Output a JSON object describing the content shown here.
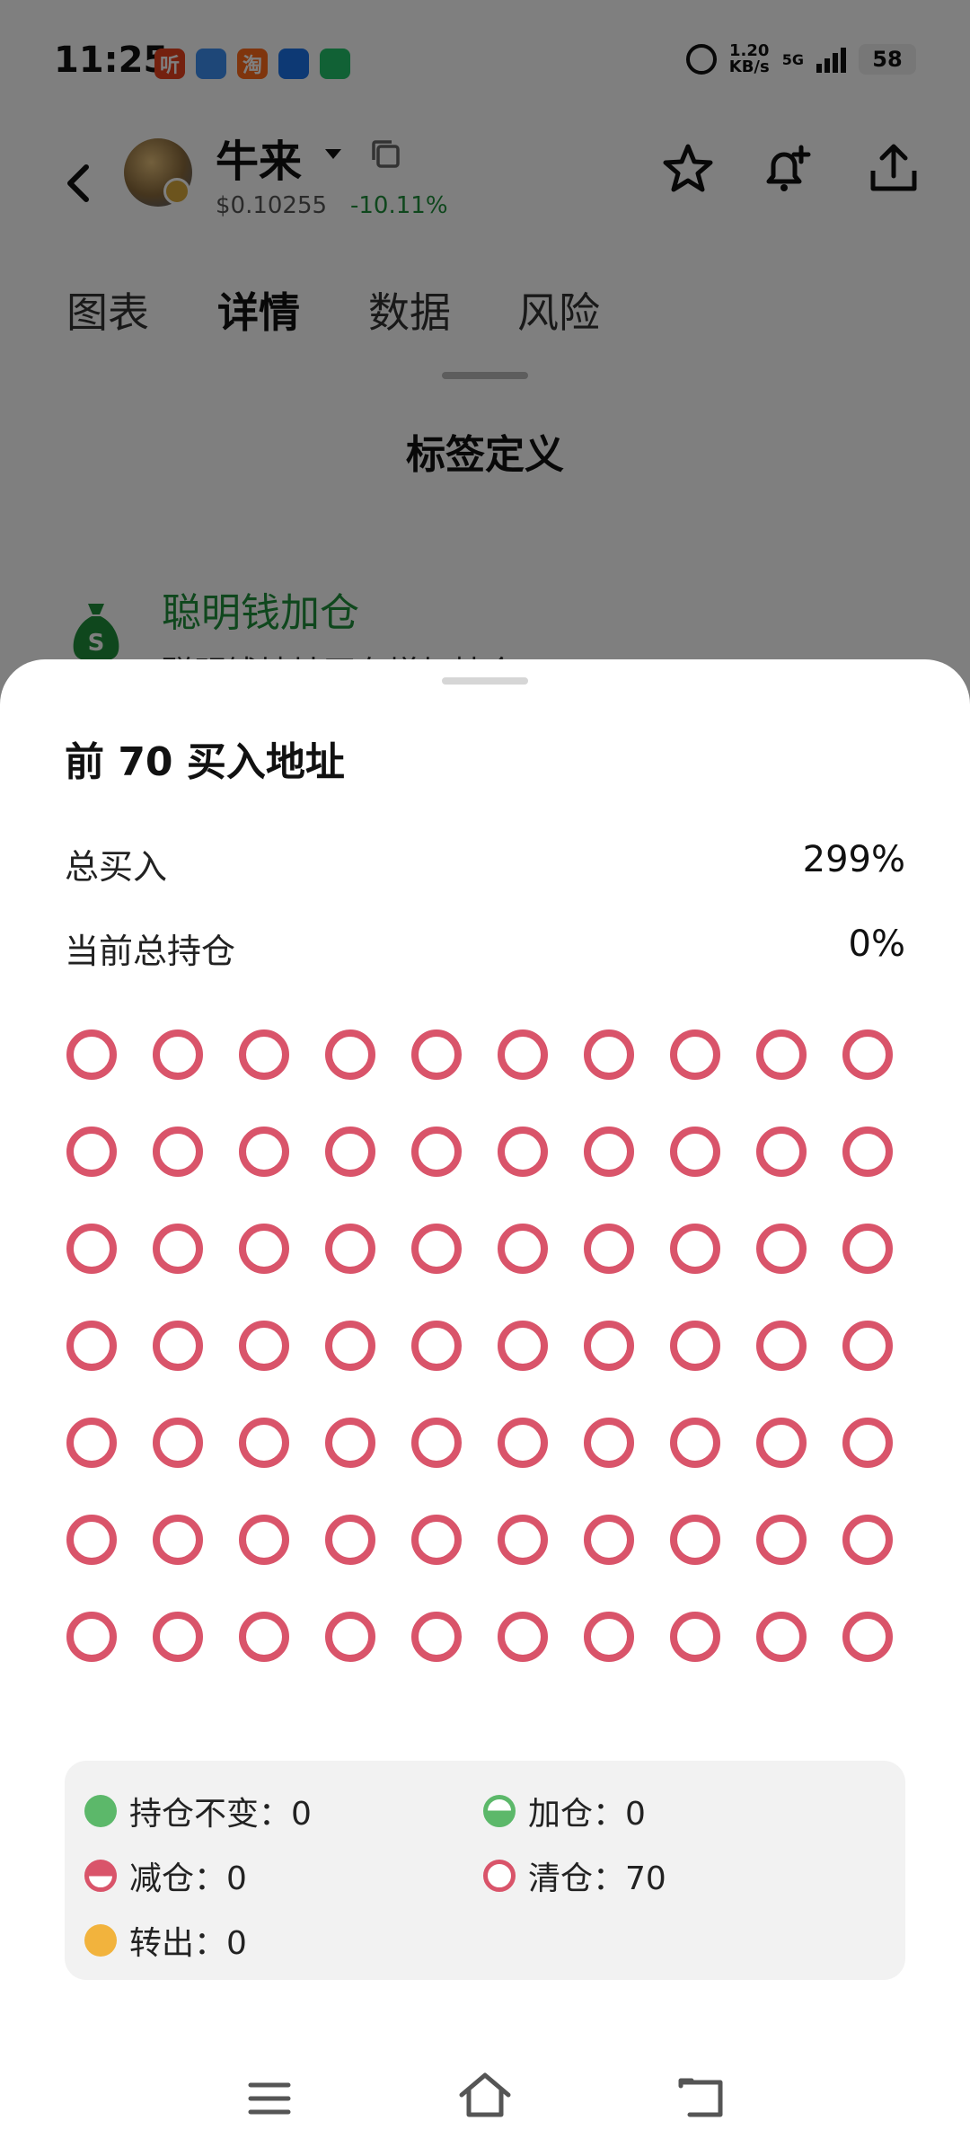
{
  "status_bar": {
    "time": "11:25",
    "notification_apps": [
      {
        "label": "听",
        "color": "#e8421f"
      },
      {
        "label": "",
        "color": "#3d8ef0"
      },
      {
        "label": "淘",
        "color": "#ff6a1a"
      },
      {
        "label": "",
        "color": "#1a73e8"
      },
      {
        "label": "",
        "color": "#22c36a"
      }
    ],
    "net_speed_value": "1.20",
    "net_speed_unit": "KB/s",
    "network_type": "5G",
    "battery": "58"
  },
  "header": {
    "token_name": "牛来",
    "price": "$0.10255",
    "change": "-10.11%"
  },
  "tabs": [
    {
      "label": "图表",
      "active": false
    },
    {
      "label": "详情",
      "active": true
    },
    {
      "label": "数据",
      "active": false
    },
    {
      "label": "风险",
      "active": false
    }
  ],
  "background_sheet": {
    "title": "标签定义",
    "item_title": "聪明钱加仓",
    "item_desc": "聪明钱地址正在增加持仓"
  },
  "sheet": {
    "title": "前 70 买入地址",
    "stats": [
      {
        "label": "总买入",
        "value": "299%"
      },
      {
        "label": "当前总持仓",
        "value": "0%"
      }
    ],
    "grid": {
      "columns": 10,
      "rows": 7,
      "status": "清仓",
      "color": "#d9546a"
    },
    "legend": [
      {
        "label": "持仓不变：",
        "count": "0",
        "kind": "hold"
      },
      {
        "label": "加仓：",
        "count": "0",
        "kind": "add"
      },
      {
        "label": "减仓：",
        "count": "0",
        "kind": "reduce"
      },
      {
        "label": "清仓：",
        "count": "70",
        "kind": "clear"
      },
      {
        "label": "转出：",
        "count": "0",
        "kind": "out"
      }
    ]
  },
  "colors": {
    "positive": "#1e8f3a",
    "clear": "#d9546a",
    "hold": "#5cb86a",
    "transfer": "#f2b33d"
  }
}
